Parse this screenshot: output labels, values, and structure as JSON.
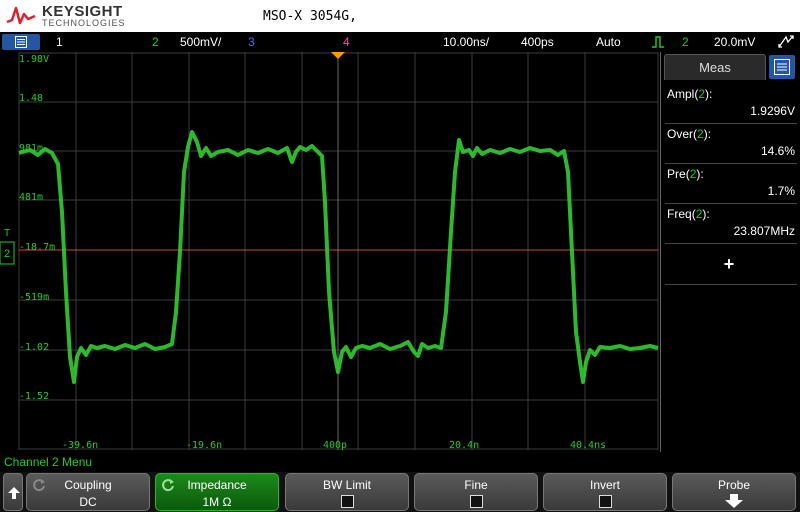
{
  "header": {
    "brand": "KEYSIGHT",
    "brand_sub": "TECHNOLOGIES",
    "model": "MSO-X 3054G,"
  },
  "status": {
    "ch1": "1",
    "ch2": "2",
    "ch2_scale": "500mV/",
    "ch3": "3",
    "ch4": "4",
    "timebase": "10.00ns/",
    "sample": "400ps",
    "mode": "Auto",
    "trig_channel": "2",
    "trig_level": "20.0mV"
  },
  "graticule": {
    "y_labels": [
      "1.98V",
      "1.48",
      "981m",
      "481m",
      "-18.7m",
      "-519m",
      "-1.02",
      "-1.52"
    ],
    "x_labels": [
      "-39.6n",
      "-19.6n",
      "400p",
      "20.4n",
      "40.4ns"
    ],
    "trig_marker": "T",
    "ch_marker": "2"
  },
  "measurements": {
    "tab_label": "Meas",
    "items": [
      {
        "name": "Ampl",
        "ch": "2",
        "value": "1.9296V"
      },
      {
        "name": "Over",
        "ch": "2",
        "value": "14.6%"
      },
      {
        "name": "Pre",
        "ch": "2",
        "value": "1.7%"
      },
      {
        "name": "Freq",
        "ch": "2",
        "value": "23.807MHz"
      }
    ],
    "add_symbol": "+"
  },
  "menu": {
    "title": "Channel 2 Menu",
    "softkeys": [
      {
        "label": "Coupling",
        "value": "DC"
      },
      {
        "label": "Impedance",
        "value": "1M Ω"
      },
      {
        "label": "BW Limit"
      },
      {
        "label": "Fine"
      },
      {
        "label": "Invert"
      },
      {
        "label": "Probe"
      }
    ]
  },
  "colors": {
    "ch1": "#e8e800",
    "ch2": "#22cc22",
    "ch3": "#4a6cff",
    "ch4": "#ff44aa",
    "trace": "#33cc33",
    "ground_line": "#ff5555",
    "active_softkey": "#1c8a1c",
    "accent_blue": "#2456a4"
  },
  "icons": {
    "menu": "menu-list-icon",
    "meas_panel": "panel-list-icon",
    "touch": "touch-gesture-icon",
    "trigger_edge": "rising-edge-icon",
    "trig_pos": "trigger-position-icon"
  }
}
